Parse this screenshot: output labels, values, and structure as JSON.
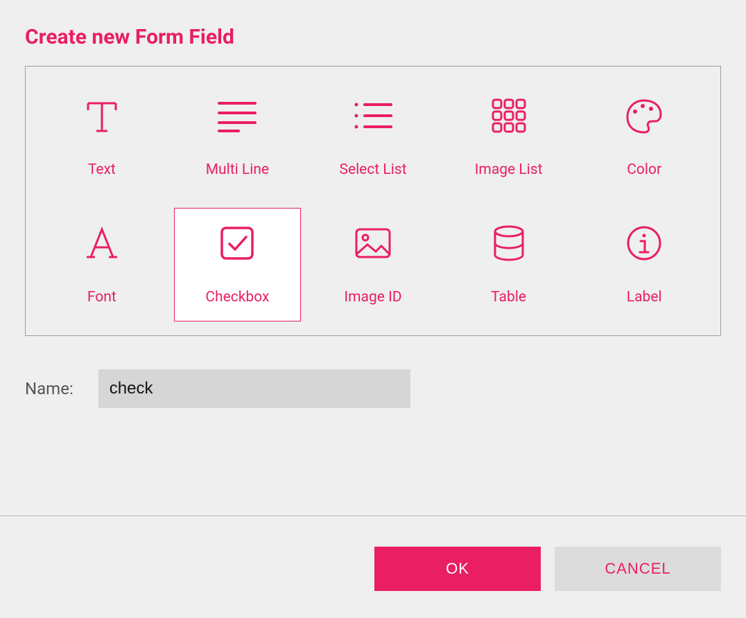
{
  "accent": "#e91e63",
  "title": "Create new Form Field",
  "options": [
    {
      "id": "text",
      "label": "Text",
      "icon": "text-icon"
    },
    {
      "id": "multiline",
      "label": "Multi Line",
      "icon": "multiline-icon"
    },
    {
      "id": "selectlist",
      "label": "Select List",
      "icon": "select-list-icon"
    },
    {
      "id": "imagelist",
      "label": "Image List",
      "icon": "image-list-icon"
    },
    {
      "id": "color",
      "label": "Color",
      "icon": "color-icon"
    },
    {
      "id": "font",
      "label": "Font",
      "icon": "font-icon"
    },
    {
      "id": "checkbox",
      "label": "Checkbox",
      "icon": "checkbox-icon"
    },
    {
      "id": "imageid",
      "label": "Image ID",
      "icon": "image-id-icon"
    },
    {
      "id": "table",
      "label": "Table",
      "icon": "table-icon"
    },
    {
      "id": "label",
      "label": "Label",
      "icon": "info-icon"
    }
  ],
  "selected_option": "checkbox",
  "name_field": {
    "label": "Name:",
    "value": "check"
  },
  "buttons": {
    "ok": "OK",
    "cancel": "CANCEL"
  }
}
